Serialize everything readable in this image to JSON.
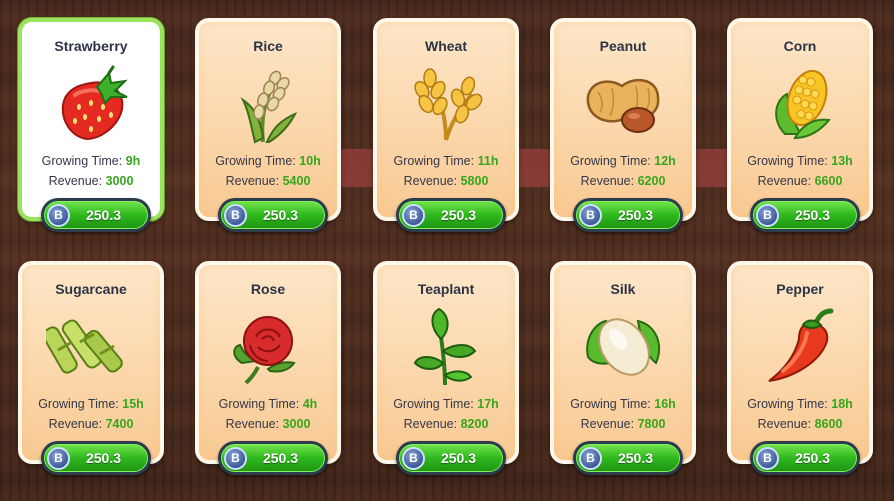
{
  "currency": {
    "symbol": "B",
    "color": "#3d5a98"
  },
  "labels": {
    "growing_time": "Growing Time:",
    "revenue": "Revenue:"
  },
  "colors": {
    "value_green": "#37a51d",
    "button_green": "#2fb81d",
    "selected_border": "#9ce35b"
  },
  "crops": [
    {
      "name": "Strawberry",
      "icon": "strawberry-icon",
      "growing_time": "9h",
      "revenue": "3000",
      "price": "250.3",
      "selected": true
    },
    {
      "name": "Rice",
      "icon": "rice-icon",
      "growing_time": "10h",
      "revenue": "5400",
      "price": "250.3",
      "selected": false
    },
    {
      "name": "Wheat",
      "icon": "wheat-icon",
      "growing_time": "11h",
      "revenue": "5800",
      "price": "250.3",
      "selected": false
    },
    {
      "name": "Peanut",
      "icon": "peanut-icon",
      "growing_time": "12h",
      "revenue": "6200",
      "price": "250.3",
      "selected": false
    },
    {
      "name": "Corn",
      "icon": "corn-icon",
      "growing_time": "13h",
      "revenue": "6600",
      "price": "250.3",
      "selected": false
    },
    {
      "name": "Sugarcane",
      "icon": "sugarcane-icon",
      "growing_time": "15h",
      "revenue": "7400",
      "price": "250.3",
      "selected": false
    },
    {
      "name": "Rose",
      "icon": "rose-icon",
      "growing_time": "4h",
      "revenue": "3000",
      "price": "250.3",
      "selected": false
    },
    {
      "name": "Teaplant",
      "icon": "teaplant-icon",
      "growing_time": "17h",
      "revenue": "8200",
      "price": "250.3",
      "selected": false
    },
    {
      "name": "Silk",
      "icon": "silk-cocoon-icon",
      "growing_time": "16h",
      "revenue": "7800",
      "price": "250.3",
      "selected": false
    },
    {
      "name": "Pepper",
      "icon": "pepper-icon",
      "growing_time": "18h",
      "revenue": "8600",
      "price": "250.3",
      "selected": false
    }
  ]
}
